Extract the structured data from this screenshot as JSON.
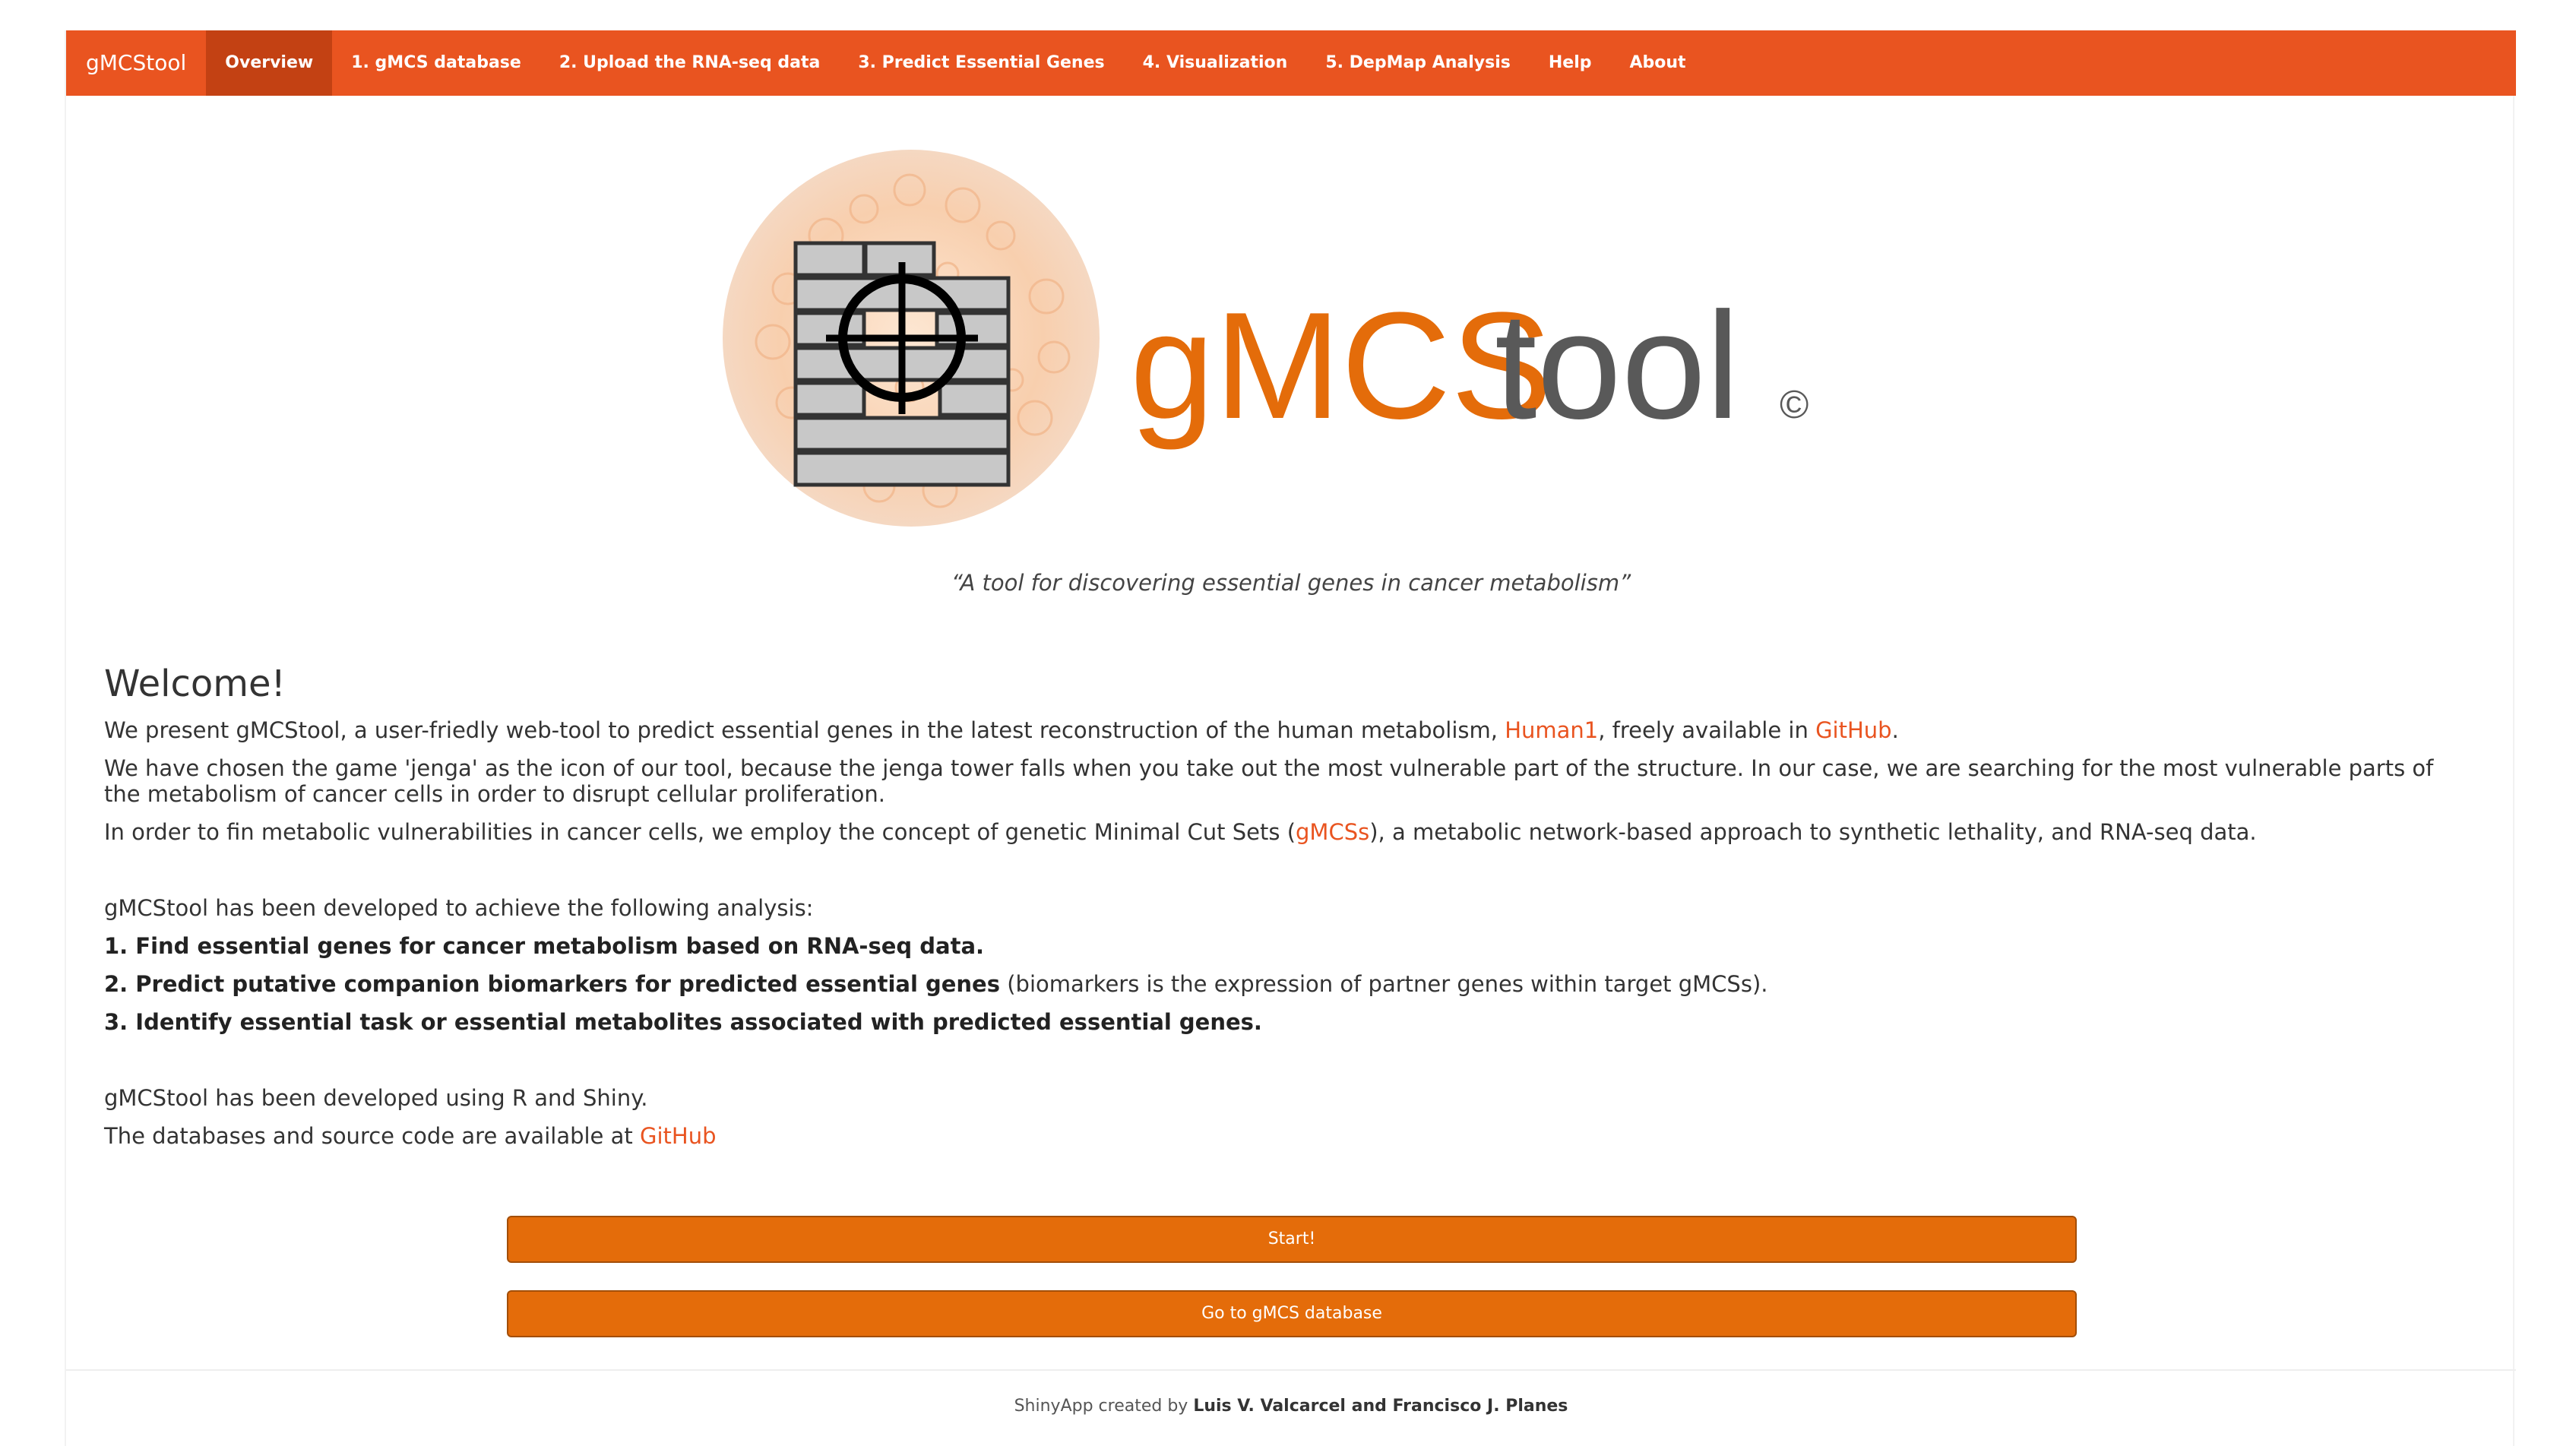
{
  "navbar": {
    "brand": "gMCStool",
    "items": [
      {
        "label": "Overview",
        "active": true
      },
      {
        "label": "1. gMCS database"
      },
      {
        "label": "2. Upload the RNA-seq data"
      },
      {
        "label": "3. Predict Essential Genes"
      },
      {
        "label": "4. Visualization"
      },
      {
        "label": "5. DepMap Analysis"
      },
      {
        "label": "Help"
      },
      {
        "label": "About"
      }
    ]
  },
  "logo": {
    "text_orange": "gMCS",
    "text_gray": "tool",
    "copyright": "©"
  },
  "tagline": "“A tool for discovering essential genes in cancer metabolism”",
  "welcome": {
    "title": "Welcome!",
    "p1_a": "We present gMCStool, a user-friedly web-tool to predict essential genes in the latest reconstruction of the human metabolism, ",
    "p1_link1": "Human1",
    "p1_b": ", freely available in ",
    "p1_link2": "GitHub",
    "p1_c": ".",
    "p2": "We have chosen the game 'jenga' as the icon of our tool, because the jenga tower falls when you take out the most vulnerable part of the structure. In our case, we are searching for the most vulnerable parts of the metabolism of cancer cells in order to disrupt cellular proliferation.",
    "p3_a": "In order to fin metabolic vulnerabilities in cancer cells, we employ the concept of genetic Minimal Cut Sets (",
    "p3_link": "gMCSs",
    "p3_b": "), a metabolic network-based approach to synthetic lethality, and RNA-seq data."
  },
  "analysis": {
    "intro": "gMCStool has been developed to achieve the following analysis:",
    "item1": "1. Find essential genes for cancer metabolism based on RNA-seq data.",
    "item2_bold": "2. Predict putative companion biomarkers for predicted essential genes",
    "item2_rest": " (biomarkers is the expression of partner genes within target gMCSs).",
    "item3": "3. Identify essential task or essential metabolites associated with predicted essential genes."
  },
  "dev": {
    "line1": "gMCStool has been developed using R and Shiny.",
    "line2_a": "The databases and source code are available at ",
    "line2_link": "GitHub"
  },
  "buttons": {
    "start": "Start!",
    "database": "Go to gMCS database"
  },
  "footer": {
    "prefix": "ShinyApp created by ",
    "authors": "Luis V. Valcarcel and Francisco J. Planes"
  },
  "colors": {
    "navbar": "#e95420",
    "active_tab": "#c34113",
    "button": "#e46c0a",
    "link": "#e95420"
  }
}
